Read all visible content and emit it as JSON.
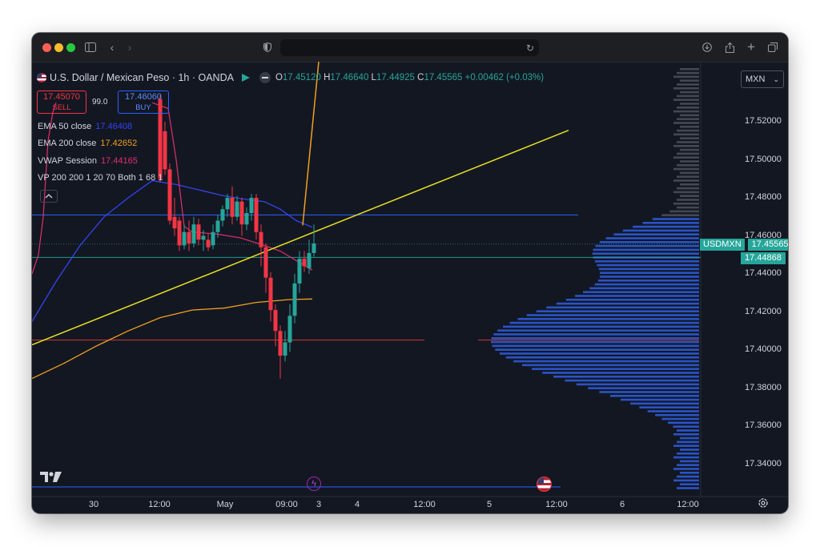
{
  "symbol": {
    "title": "U.S. Dollar / Mexican Peso · 1h · OANDA",
    "open_label": "O",
    "open": "17.45120",
    "high_label": "H",
    "high": "17.46640",
    "low_label": "L",
    "low": "17.44925",
    "close_label": "C",
    "close": "17.45565",
    "change": "+0.00462 (+0.03%)"
  },
  "trade": {
    "sell_price": "17.45070",
    "sell_label": "SELL",
    "spread": "99.0",
    "buy_price": "17.46060",
    "buy_label": "BUY"
  },
  "indicators": [
    {
      "label": "EMA 50 close",
      "value": "17.46408",
      "color": "#3344ee"
    },
    {
      "label": "EMA 200 close",
      "value": "17.42652",
      "color": "#f0a020"
    },
    {
      "label": "VWAP Session",
      "value": "17.44165",
      "color": "#e0306a"
    },
    {
      "label": "VP 200 200 1 20 70 Both 1 68 1",
      "value": "",
      "color": "#d1d4dc"
    }
  ],
  "currency": "MXN",
  "price_axis": [
    "17.52000",
    "17.50000",
    "17.48000",
    "17.46000",
    "17.44000",
    "17.42000",
    "17.40000",
    "17.38000",
    "17.36000",
    "17.34000"
  ],
  "last_price": {
    "symbol": "USDMXN",
    "value": "17.45565",
    "color": "#26a69a"
  },
  "crosshair_price": {
    "value": "17.44868",
    "color": "#26a69a"
  },
  "time_axis": [
    "30",
    "12:00",
    "May",
    "09:00",
    "3",
    "4",
    "12:00",
    "5",
    "12:00",
    "6",
    "12:00"
  ],
  "colors": {
    "up": "#26a69a",
    "down": "#f23645",
    "background": "#131722"
  }
}
